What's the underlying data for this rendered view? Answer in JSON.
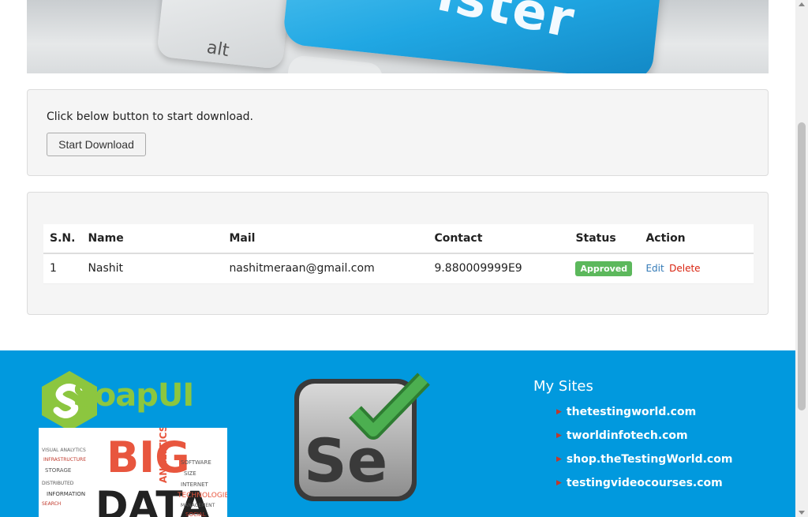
{
  "banner": {
    "key_text": "ister",
    "alt_key": "alt"
  },
  "download": {
    "instruction": "Click below button to start download.",
    "button_label": "Start Download"
  },
  "table": {
    "headers": [
      "S.N.",
      "Name",
      "Mail",
      "Contact",
      "Status",
      "Action"
    ],
    "rows": [
      {
        "sn": "1",
        "name": "Nashit",
        "mail": "nashitmeraan@gmail.com",
        "contact": "9.880009999E9",
        "status": "Approved",
        "edit": "Edit",
        "delete": "Delete"
      }
    ]
  },
  "footer": {
    "soapui_text": "SoapUI",
    "bigdata_word1": "BIG",
    "bigdata_word2": "DATA",
    "selenium_text": "Se",
    "sites_title": "My Sites",
    "sites": [
      "thetestingworld.com",
      "tworldinfotech.com",
      "shop.theTestingWorld.com",
      "testingvideocourses.com"
    ]
  },
  "colors": {
    "footer_bg": "#0199de",
    "approved_badge": "#5cb85c",
    "edit_link": "#337ab7",
    "delete_link": "#d9230f",
    "soapui_green": "#8cc63f"
  }
}
